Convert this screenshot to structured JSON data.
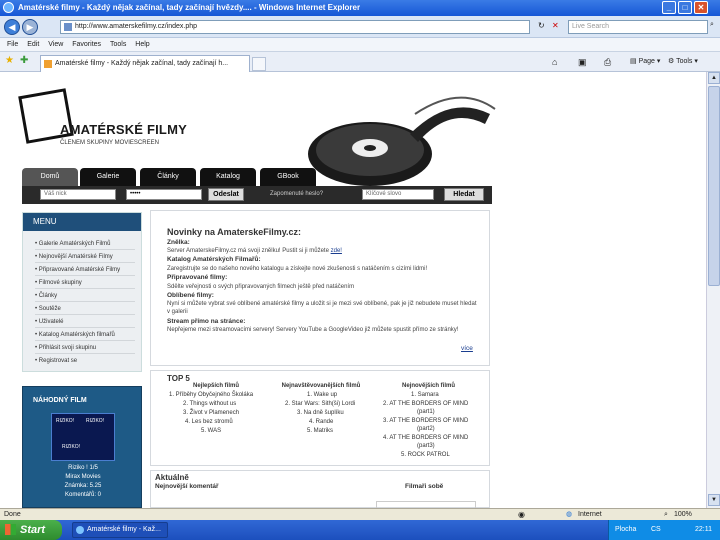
{
  "window": {
    "title": "Amatérské filmy - Každý nějak začínal, tady začínají hvězdy.... - Windows Internet Explorer"
  },
  "address": {
    "url": "http://www.amaterskefilmy.cz/index.php",
    "search_placeholder": "Live Search"
  },
  "menubar": [
    "File",
    "Edit",
    "View",
    "Favorites",
    "Tools",
    "Help"
  ],
  "tab": {
    "title": "Amatérské filmy - Každý nějak začínal, tady začínají h..."
  },
  "toolbar": {
    "page": "Page",
    "tools": "Tools"
  },
  "site": {
    "logo_title": "AMATÉRSKÉ FILMY",
    "logo_subtitle": "ČLENEM SKUPINY MOVIESCREEN",
    "nav": [
      "Domů",
      "Galerie",
      "Články",
      "Katalog",
      "GBook"
    ],
    "login": {
      "nick_placeholder": "Váš nick",
      "password_value": "•••••",
      "submit": "Odeslat",
      "forgot": "Zapomenuté heslo?",
      "search_placeholder": "Klíčové slovo",
      "search_button": "Hledat"
    },
    "menu": {
      "title": "MENU",
      "items": [
        "Galerie Amatérských Filmů",
        "Nejnovější Amatérské Filmy",
        "Připravované Amatérské Filmy",
        "Filmové skupiny",
        "Články",
        "Soutěže",
        "Uživatelé",
        "Katalog Amatérských filmařů",
        "Přihlásit svoji skupinu",
        "Registrovat se"
      ]
    },
    "random": {
      "title": "NÁHODNÝ FILM",
      "poster_text": "RIZIKO!",
      "name": "Riziko ! 1/5",
      "studio": "Mirax Movies",
      "rating": "Známka: 5.25",
      "comments": "Komentářů: 0"
    },
    "news": {
      "title": "Novinky na AmaterskeFilmy.cz:",
      "items": [
        {
          "heading": "Znělka:",
          "text": "Server AmaterskeFilmy.cz má svoji znělku! Pustit si ji můžete",
          "link": "zde!"
        },
        {
          "heading": "Katalog Amatérských Filmařů:",
          "text": "Zaregistrujte se do našeho nového katalogu a získejte nové zkušenosti s natáčením s cizími lidmi!"
        },
        {
          "heading": "Připravované filmy:",
          "text": "Sdělte veřejnosti o svých připravovaných filmech ještě před natáčením"
        },
        {
          "heading": "Oblíbené filmy:",
          "text": "Nyní si můžete vybrat své oblíbené amatérské filmy a uložit si je mezi své oblíbené, pak je již nebudete muset hledat v galerii"
        },
        {
          "heading": "Stream přímo na stránce:",
          "text": "Nepřejeme mezi streamovacími servery! Servery YouTube a GoogleVideo již můžete spustit přímo ze stránky!"
        }
      ],
      "more": "více"
    },
    "top5": {
      "title": "TOP 5",
      "columns": [
        {
          "header": "Nejlepších filmů",
          "items": [
            "1. Příběhy Obyčejného Školáka",
            "2. Things without us",
            "3. Život v Plamenech",
            "4. Les bez stromů",
            "5. WAS"
          ]
        },
        {
          "header": "Nejnavštěvovanějších filmů",
          "items": [
            "1. Wake up",
            "2. Star Wars: Sith(ši) Lordi",
            "3. Na dně šuplíku",
            "4. Rande",
            "5. Matriks"
          ]
        },
        {
          "header": "Nejnovějších filmů",
          "items": [
            "1. Samara",
            "2. AT THE BORDERS OF MIND",
            "(part1)",
            "3. AT THE BORDERS OF MIND",
            "(part2)",
            "4. AT THE BORDERS OF MIND",
            "(part3)",
            "5. ROCK PATROL"
          ]
        }
      ]
    },
    "aktualne": {
      "title": "Aktuálně",
      "col1": "Nejnovější komentář",
      "col2": "Filmaři sobě"
    }
  },
  "statusbar": {
    "text": "Done",
    "zone": "Internet",
    "zoom": "100%"
  },
  "taskbar": {
    "start": "Start",
    "item": "Amatérské filmy - Kaž...",
    "tray_desktop": "Plocha",
    "lang": "CS",
    "clock": "22:11"
  }
}
